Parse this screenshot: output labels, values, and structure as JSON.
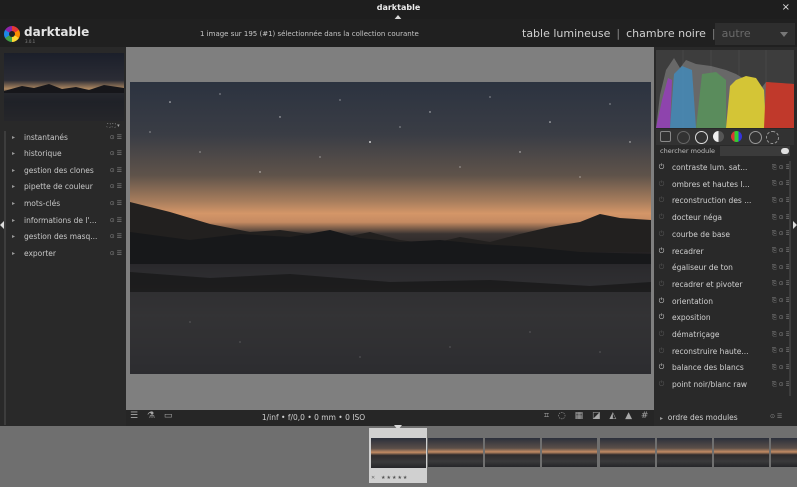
{
  "window": {
    "title": "darktable",
    "close_icon": "×"
  },
  "header": {
    "logo_text": "darktable",
    "version": "3.0.1",
    "collection_info": "1 image sur 195 (#1) sélectionnée dans la collection courante",
    "views": {
      "lighttable": "table lumineuse",
      "darkroom": "chambre noire",
      "other": "autre",
      "separator": "|"
    }
  },
  "left_panel": {
    "navigator_controls": "⛶ ⛶ ▾",
    "modules": [
      {
        "label": "instantanés"
      },
      {
        "label": "historique"
      },
      {
        "label": "gestion des clones"
      },
      {
        "label": "pipette de couleur"
      },
      {
        "label": "mots-clés"
      },
      {
        "label": "informations de l'..."
      },
      {
        "label": "gestion des masq..."
      },
      {
        "label": "exporter"
      }
    ],
    "module_controls": "⊙ ☰",
    "expander_icon": "▸"
  },
  "center": {
    "exif_info": "1/inf • f/0,0 • 0 mm • 0 ISO",
    "left_tools": "☰ ⚗ ▭",
    "right_tools": "⌗ ◌ ▦ ◪ ◭ ▲ #"
  },
  "right_panel": {
    "search_label": "chercher module",
    "search_value": "",
    "modules": [
      {
        "label": "contraste lum. sat...",
        "on": true
      },
      {
        "label": "ombres et hautes l...",
        "on": false
      },
      {
        "label": "reconstruction des ...",
        "on": false
      },
      {
        "label": "docteur néga",
        "on": false
      },
      {
        "label": "courbe de base",
        "on": false
      },
      {
        "label": "recadrer",
        "on": true
      },
      {
        "label": "égaliseur de ton",
        "on": false
      },
      {
        "label": "recadrer et pivoter",
        "on": false
      },
      {
        "label": "orientation",
        "on": true
      },
      {
        "label": "exposition",
        "on": true
      },
      {
        "label": "dématriçage",
        "on": false
      },
      {
        "label": "reconstruire haute...",
        "on": false
      },
      {
        "label": "balance des blancs",
        "on": true
      },
      {
        "label": "point noir/blanc raw",
        "on": false
      }
    ],
    "module_controls": "⎘ ⊙ ☰",
    "power_icon": "⏻",
    "module_order": "ordre des modules",
    "module_order_controls": "⊙ ☰"
  },
  "filmstrip": {
    "rating": "★★★★★",
    "reject": "✕"
  },
  "colors": {
    "accent": "#d0d0d0",
    "histogram_red": "#c0392b",
    "histogram_yellow": "#d4c536",
    "histogram_green": "#4caf50"
  }
}
